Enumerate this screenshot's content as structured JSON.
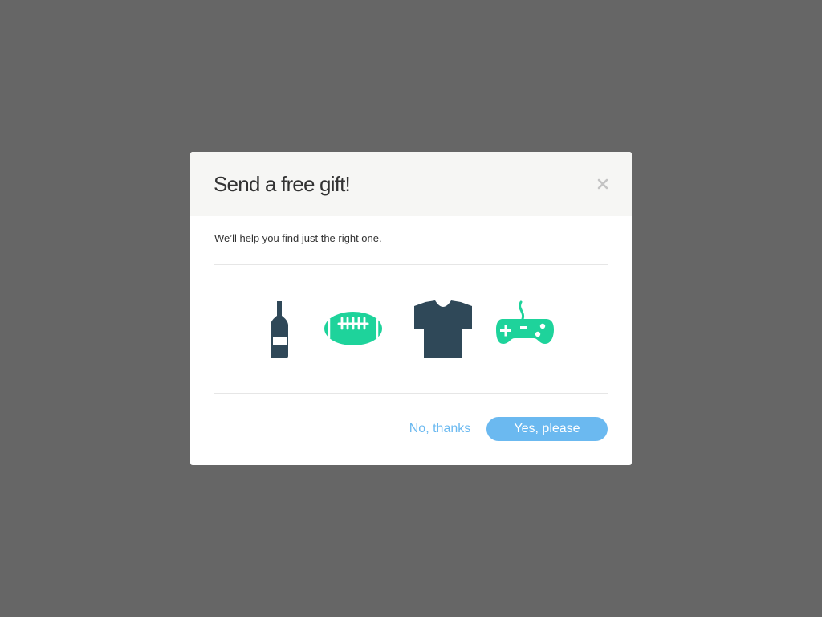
{
  "modal": {
    "title": "Send a free gift!",
    "close_icon": "close-icon",
    "subtitle": "We’ll help you find just the right one.",
    "gift_options": [
      {
        "icon": "wine-bottle-icon",
        "color": "#2f4858"
      },
      {
        "icon": "football-icon",
        "color": "#1ed39b"
      },
      {
        "icon": "t-shirt-icon",
        "color": "#2f4858"
      },
      {
        "icon": "gamepad-icon",
        "color": "#1ed39b"
      }
    ],
    "buttons": {
      "decline_label": "No, thanks",
      "accept_label": "Yes, please"
    }
  },
  "colors": {
    "overlay": "#666666",
    "header_bg": "#f6f6f4",
    "accent": "#6bb9f0",
    "icon_dark": "#2f4858",
    "icon_green": "#1ed39b"
  }
}
